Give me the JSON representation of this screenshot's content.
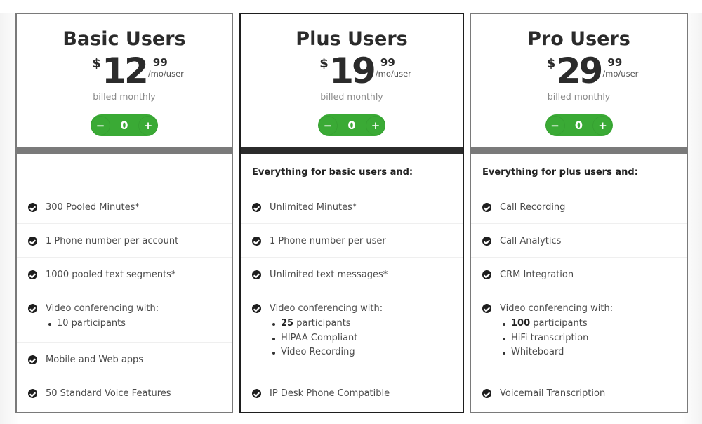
{
  "colors": {
    "stepper_green": "#3aaa35",
    "band_default": "#7a7a7a",
    "band_featured": "#2b2b2b",
    "text_dark": "#2b2b2b"
  },
  "plans": [
    {
      "name": "Basic Users",
      "currency": "$",
      "price_whole": "12",
      "price_cents": "99",
      "period": "/mo/user",
      "billing": "billed monthly",
      "quantity": "0",
      "decrement_label": "−",
      "increment_label": "+",
      "intro": "",
      "features": [
        {
          "text": "300 Pooled Minutes*"
        },
        {
          "text": "1 Phone number per account"
        },
        {
          "text": "1000 pooled text segments*"
        },
        {
          "text": "Video conferencing with:",
          "sub": [
            {
              "bold": "",
              "text": "10 participants"
            }
          ]
        },
        {
          "text": "Mobile and Web apps"
        },
        {
          "text": "50 Standard Voice Features"
        }
      ]
    },
    {
      "name": "Plus Users",
      "currency": "$",
      "price_whole": "19",
      "price_cents": "99",
      "period": "/mo/user",
      "billing": "billed monthly",
      "quantity": "0",
      "decrement_label": "−",
      "increment_label": "+",
      "intro": "Everything for basic users and:",
      "features": [
        {
          "text": "Unlimited Minutes*"
        },
        {
          "text": "1 Phone number per user"
        },
        {
          "text": "Unlimited text messages*"
        },
        {
          "text": "Video conferencing with:",
          "sub": [
            {
              "bold": "25",
              "text": " participants"
            },
            {
              "bold": "",
              "text": "HIPAA Compliant"
            },
            {
              "bold": "",
              "text": "Video Recording"
            }
          ]
        },
        {
          "text": "IP Desk Phone Compatible"
        }
      ]
    },
    {
      "name": "Pro Users",
      "currency": "$",
      "price_whole": "29",
      "price_cents": "99",
      "period": "/mo/user",
      "billing": "billed monthly",
      "quantity": "0",
      "decrement_label": "−",
      "increment_label": "+",
      "intro": "Everything for plus users and:",
      "features": [
        {
          "text": "Call Recording"
        },
        {
          "text": "Call Analytics"
        },
        {
          "text": "CRM Integration"
        },
        {
          "text": "Video conferencing with:",
          "sub": [
            {
              "bold": "100",
              "text": " participants"
            },
            {
              "bold": "",
              "text": "HiFi transcription"
            },
            {
              "bold": "",
              "text": "Whiteboard"
            }
          ]
        },
        {
          "text": "Voicemail Transcription"
        }
      ]
    }
  ]
}
